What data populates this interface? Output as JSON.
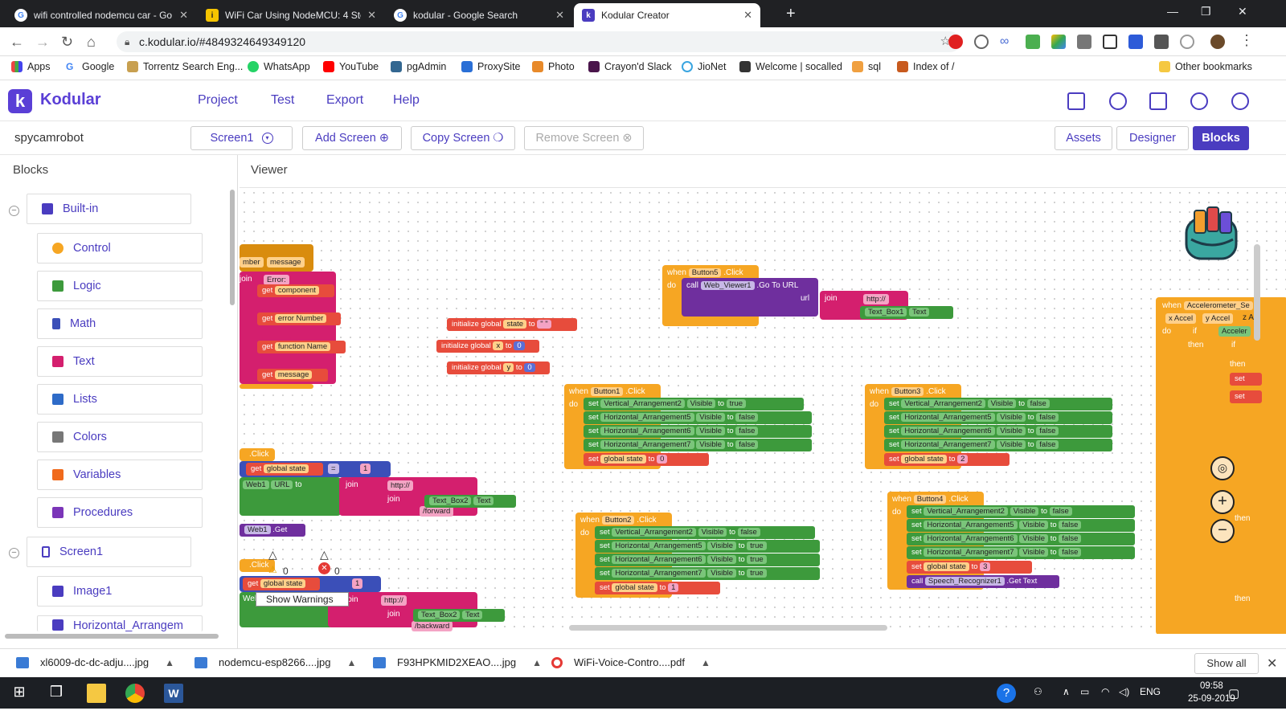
{
  "browser": {
    "tabs": [
      {
        "title": "wifi controlled nodemcu car - Go",
        "icon": "google-icon"
      },
      {
        "title": "WiFi Car Using NodeMCU: 4 Step",
        "icon": "instructables-icon"
      },
      {
        "title": "kodular - Google Search",
        "icon": "google-icon"
      },
      {
        "title": "Kodular Creator",
        "icon": "kodular-icon"
      }
    ],
    "url": "c.kodular.io/#4849324649349120",
    "bookmarks": [
      "Apps",
      "Google",
      "Torrentz Search Eng...",
      "WhatsApp",
      "YouTube",
      "pgAdmin",
      "ProxySite",
      "Photo",
      "Crayon'd Slack",
      "JioNet",
      "Welcome | socalled",
      "sql",
      "Index of /"
    ],
    "other_bookmarks": "Other bookmarks"
  },
  "app": {
    "name": "Kodular",
    "menu": [
      "Project",
      "Test",
      "Export",
      "Help"
    ],
    "project_name": "spycamrobot",
    "screen_select": "Screen1",
    "add_screen": "Add Screen",
    "copy_screen": "Copy Screen",
    "remove_screen": "Remove Screen",
    "assets": "Assets",
    "designer": "Designer",
    "blocks": "Blocks"
  },
  "panel": {
    "title": "Blocks",
    "builtin": "Built-in",
    "items": [
      "Control",
      "Logic",
      "Math",
      "Text",
      "Lists",
      "Colors",
      "Variables",
      "Procedures"
    ],
    "screen": "Screen1",
    "screen_items": [
      "Image1",
      "Horizontal_Arrangem"
    ]
  },
  "viewer": {
    "title": "Viewer",
    "warnings_count": "0",
    "errors_count": "0",
    "show_warnings": "Show Warnings"
  },
  "blocks": {
    "when": "when",
    "do": "do",
    "set": "set",
    "to": "to",
    "get": "get",
    "call": "call",
    "join": "join",
    "url": "url",
    "then": "then",
    "if": "if",
    "click": ".Click",
    "visible": "Visible",
    "text": "Text",
    "get_text": ".Get Text",
    "go_to_url": ".Go To URL",
    "url_prop": "URL",
    "get_method": ".Get",
    "init_global": "initialize global",
    "global_state": "global state",
    "var_state": "state",
    "var_x": "x",
    "var_y": "y",
    "zero": "0",
    "one": "1",
    "two": "2",
    "three": "3",
    "true": "true",
    "false": "false",
    "http": "http://",
    "forward": "/forward",
    "backward": "/backward",
    "error": "Error:",
    "component": "component",
    "error_number": "error Number",
    "function_name": "function Name",
    "message": "message",
    "number_frag": "mber",
    "button1": "Button1",
    "button2": "Button2",
    "button3": "Button3",
    "button4": "Button4",
    "button5": "Button5",
    "va2": "Vertical_Arrangement2",
    "ha5": "Horizontal_Arrangement5",
    "ha6": "Horizontal_Arrangement6",
    "ha7": "Horizontal_Arrangement7",
    "text_box1": "Text_Box1",
    "text_box2": "Text_Box2",
    "web_viewer1": "Web_Viewer1",
    "web1": "Web1",
    "speech": "Speech_Recognizer1",
    "accel": "Accelerometer_Se",
    "x_accel": "x Accel",
    "y_accel": "y Accel",
    "z_frag": "z A",
    "accel_frag": "Acceler",
    "equals": "="
  },
  "downloads": [
    {
      "name": "xl6009-dc-dc-adju....jpg"
    },
    {
      "name": "nodemcu-esp8266....jpg"
    },
    {
      "name": "F93HPKMID2XEAO....jpg"
    },
    {
      "name": "WiFi-Voice-Contro....pdf"
    }
  ],
  "show_all": "Show all",
  "taskbar": {
    "lang": "ENG",
    "time": "09:58",
    "date": "25-09-2019"
  },
  "colors": {
    "kodular_purple": "#4a3cc0",
    "event_orange": "#f6a623",
    "setter_green": "#3d9a3c",
    "text_pink": "#d41f6e"
  }
}
